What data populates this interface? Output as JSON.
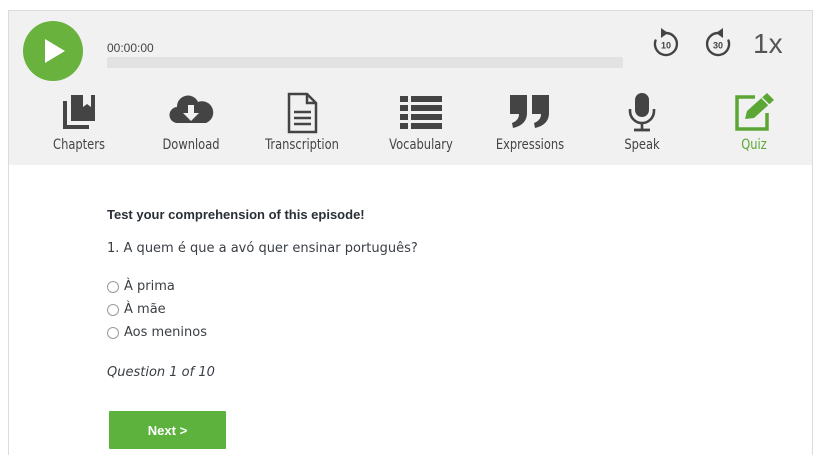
{
  "player": {
    "current_time": "00:00:00",
    "progress": 0,
    "skip_back_seconds": "10",
    "skip_forward_seconds": "30",
    "speed": "1x",
    "accent_color": "#6ab23e"
  },
  "tabs": [
    {
      "label": "Chapters",
      "icon": "chapters-icon",
      "active": false
    },
    {
      "label": "Download",
      "icon": "cloud-download-icon",
      "active": false
    },
    {
      "label": "Transcription",
      "icon": "document-icon",
      "active": false
    },
    {
      "label": "Vocabulary",
      "icon": "list-icon",
      "active": false
    },
    {
      "label": "Expressions",
      "icon": "quote-icon",
      "active": false
    },
    {
      "label": "Speak",
      "icon": "microphone-icon",
      "active": false
    },
    {
      "label": "Quiz",
      "icon": "edit-icon",
      "active": true
    }
  ],
  "quiz": {
    "heading": "Test your comprehension of this episode!",
    "question": "1. A quem é que a avó quer ensinar português?",
    "options": [
      "À prima",
      "À mãe",
      "Aos meninos"
    ],
    "counter": "Question 1 of 10",
    "next_label": "Next >"
  },
  "colors": {
    "active_tab": "#5ba634",
    "button": "#5cb23c",
    "icon_gray": "#444444"
  }
}
